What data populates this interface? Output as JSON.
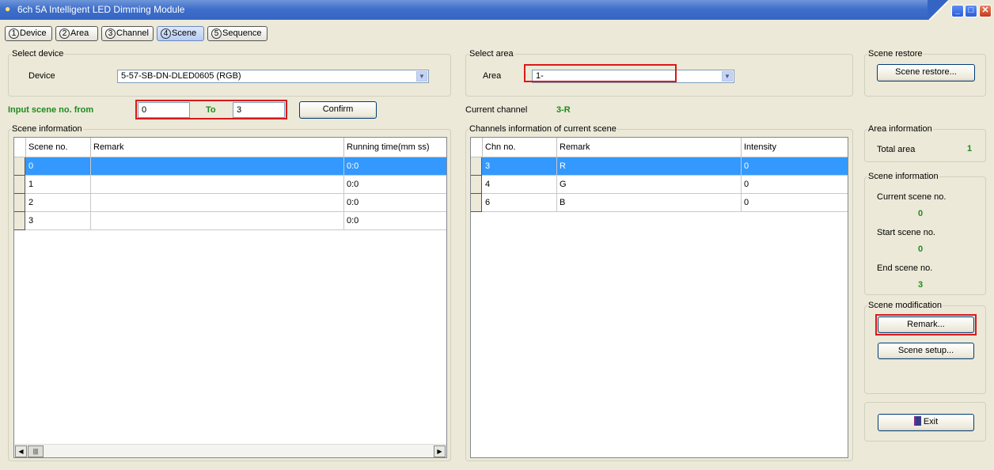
{
  "window": {
    "title": "6ch 5A Intelligent LED Dimming Module"
  },
  "tabs": [
    {
      "num": "1",
      "label": "Device"
    },
    {
      "num": "2",
      "label": "Area"
    },
    {
      "num": "3",
      "label": "Channel"
    },
    {
      "num": "4",
      "label": "Scene"
    },
    {
      "num": "5",
      "label": "Sequence"
    }
  ],
  "select_device": {
    "group": "Select device",
    "label": "Device",
    "value": "5-57-SB-DN-DLED0605 (RGB)"
  },
  "select_area": {
    "group": "Select area",
    "label": "Area",
    "value": "1-"
  },
  "scene_restore": {
    "group": "Scene restore",
    "button": "Scene restore..."
  },
  "input_scene": {
    "label": "Input scene no. from",
    "from": "0",
    "to_label": "To",
    "to": "3",
    "confirm": "Confirm"
  },
  "current_channel": {
    "label": "Current channel",
    "value": "3-R"
  },
  "scene_info": {
    "group": "Scene information",
    "columns": [
      "Scene no.",
      "Remark",
      "Running time(mm ss)"
    ],
    "rows": [
      [
        "0",
        "",
        "0:0"
      ],
      [
        "1",
        "",
        "0:0"
      ],
      [
        "2",
        "",
        "0:0"
      ],
      [
        "3",
        "",
        "0:0"
      ]
    ]
  },
  "channels_info": {
    "group": "Channels information of current scene",
    "columns": [
      "Chn no.",
      "Remark",
      "Intensity"
    ],
    "rows": [
      [
        "3",
        "R",
        "0"
      ],
      [
        "4",
        "G",
        "0"
      ],
      [
        "6",
        "B",
        "0"
      ]
    ]
  },
  "area_info": {
    "group": "Area information",
    "label": "Total area",
    "value": "1"
  },
  "scene_info_side": {
    "group": "Scene information",
    "current_label": "Current scene no.",
    "current": "0",
    "start_label": "Start scene no.",
    "start": "0",
    "end_label": "End scene no.",
    "end": "3"
  },
  "scene_mod": {
    "group": "Scene modification",
    "remark": "Remark...",
    "setup": "Scene setup..."
  },
  "exit": {
    "label": "Exit"
  }
}
